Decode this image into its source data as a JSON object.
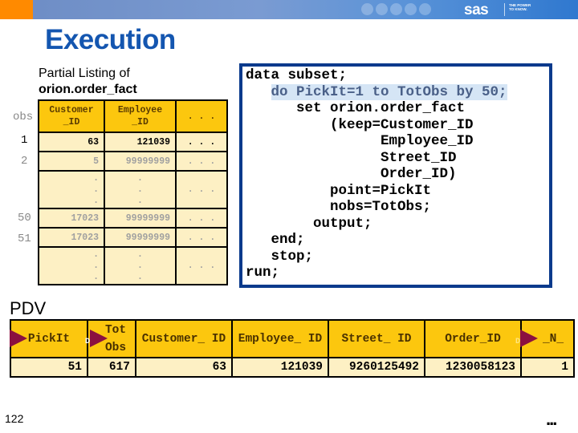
{
  "header": {
    "logo": "sas",
    "tagline": "THE POWER TO KNOW."
  },
  "title": "Execution",
  "listing": {
    "caption_line1": "Partial Listing of",
    "caption_line2": "orion.order_fact",
    "obs_label": "obs",
    "columns": [
      "Customer _ID",
      "Employee _ID",
      ". . ."
    ],
    "rows": [
      {
        "obs": "1",
        "customer_id": "63",
        "employee_id": "121039",
        "more": ". . ."
      },
      {
        "obs": "2",
        "customer_id": "5",
        "employee_id": "99999999",
        "more": ". . ."
      },
      {
        "obs": "",
        "customer_id": ".\n.\n.",
        "employee_id": ".\n.\n.",
        "more": ". . ."
      },
      {
        "obs": "50",
        "customer_id": "17023",
        "employee_id": "99999999",
        "more": ". . ."
      },
      {
        "obs": "51",
        "customer_id": "17023",
        "employee_id": "99999999",
        "more": ". . ."
      },
      {
        "obs": "",
        "customer_id": ".\n.\n.",
        "employee_id": ".\n.\n.",
        "more": ". . ."
      }
    ]
  },
  "code": {
    "lines": [
      "data subset;",
      "   do PickIt=1 to TotObs by 50;",
      "      set orion.order_fact",
      "          (keep=Customer_ID",
      "                Employee_ID",
      "                Street_ID",
      "                Order_ID)",
      "          point=PickIt",
      "          nobs=TotObs;",
      "        output;",
      "   end;",
      "   stop;",
      "run;"
    ],
    "highlighted_line": 1
  },
  "pdv": {
    "label": "PDV",
    "columns": [
      "PickIt",
      "Tot Obs",
      "Customer_ ID",
      "Employee_ ID",
      "Street_ ID",
      "Order_ID",
      "_N_"
    ],
    "values": [
      "51",
      "617",
      "63",
      "121039",
      "9260125492",
      "1230058123",
      "1"
    ],
    "drop_marker": "D"
  },
  "footer": {
    "page_number": "122",
    "more_indicator": "..."
  },
  "colors": {
    "title": "#1456b0",
    "header_gold": "#fcc70e",
    "row_cream": "#fdf0c4",
    "code_border": "#0a3a8c",
    "arrow": "#8b1040",
    "orange_tab": "#ff8a00"
  }
}
